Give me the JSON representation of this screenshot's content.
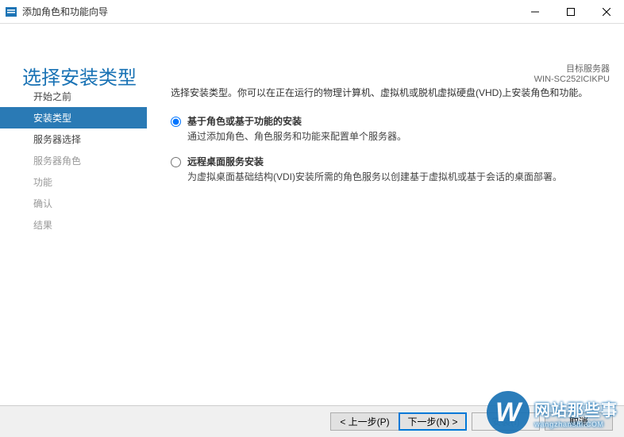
{
  "window": {
    "title": "添加角色和功能向导"
  },
  "header": {
    "page_title": "选择安装类型",
    "target_label": "目标服务器",
    "target_name": "WIN-SC252ICIKPU"
  },
  "sidebar": {
    "items": [
      {
        "label": "开始之前",
        "state": "normal"
      },
      {
        "label": "安装类型",
        "state": "active"
      },
      {
        "label": "服务器选择",
        "state": "normal"
      },
      {
        "label": "服务器角色",
        "state": "disabled"
      },
      {
        "label": "功能",
        "state": "disabled"
      },
      {
        "label": "确认",
        "state": "disabled"
      },
      {
        "label": "结果",
        "state": "disabled"
      }
    ]
  },
  "main": {
    "intro": "选择安装类型。你可以在正在运行的物理计算机、虚拟机或脱机虚拟硬盘(VHD)上安装角色和功能。",
    "options": [
      {
        "title": "基于角色或基于功能的安装",
        "desc": "通过添加角色、角色服务和功能来配置单个服务器。",
        "checked": true
      },
      {
        "title": "远程桌面服务安装",
        "desc": "为虚拟桌面基础结构(VDI)安装所需的角色服务以创建基于虚拟机或基于会话的桌面部署。",
        "checked": false
      }
    ]
  },
  "footer": {
    "prev": "< 上一步(P)",
    "next": "下一步(N) >",
    "install": "安装(I)",
    "cancel": "取消"
  },
  "watermark": {
    "line1": "网站那些事",
    "line2": "wangzhanshi.COM"
  }
}
